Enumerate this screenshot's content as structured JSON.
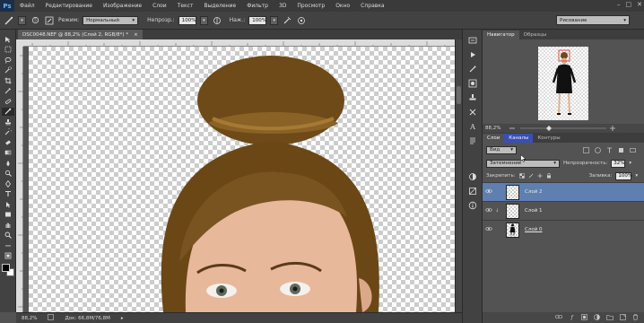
{
  "app": {
    "logo": "Ps"
  },
  "menu": [
    "Файл",
    "Редактирование",
    "Изображение",
    "Слои",
    "Текст",
    "Выделение",
    "Фильтр",
    "3D",
    "Просмотр",
    "Окно",
    "Справка"
  ],
  "window_controls": {
    "minimize": "–",
    "maximize": "□",
    "close": "✕"
  },
  "options": {
    "mode_label": "Режим:",
    "mode_value": "Нормальный",
    "opacity_label": "Непрозр.:",
    "opacity_value": "100%",
    "pressure_label": "Наж.:",
    "pressure_value": "100%",
    "workspace_value": "Рисование"
  },
  "document": {
    "tab_title": "DSC0048.NEF @ 88,2% (Слой 2, RGB/8*) *",
    "tab_close": "×"
  },
  "status": {
    "zoom": "88,2%",
    "doc_size": "Док: 66,8M/76,8M"
  },
  "navigator": {
    "tabs": [
      "Навигатор",
      "Образцы"
    ],
    "zoom": "88,2%"
  },
  "layers_panel": {
    "tabs": [
      "Слои",
      "Каналы",
      "Контуры"
    ],
    "kind_filter": "Вид",
    "blend_mode": "Затемнение",
    "opacity_label": "Непрозрачность:",
    "opacity_value": "32%",
    "lock_label": "Закрепить:",
    "fill_label": "Заливка:",
    "fill_value": "100%",
    "layers": [
      {
        "name": "Слой 2",
        "selected": true
      },
      {
        "name": "Слой 1",
        "selected": false
      },
      {
        "name": "Слой 0",
        "selected": false
      }
    ]
  }
}
